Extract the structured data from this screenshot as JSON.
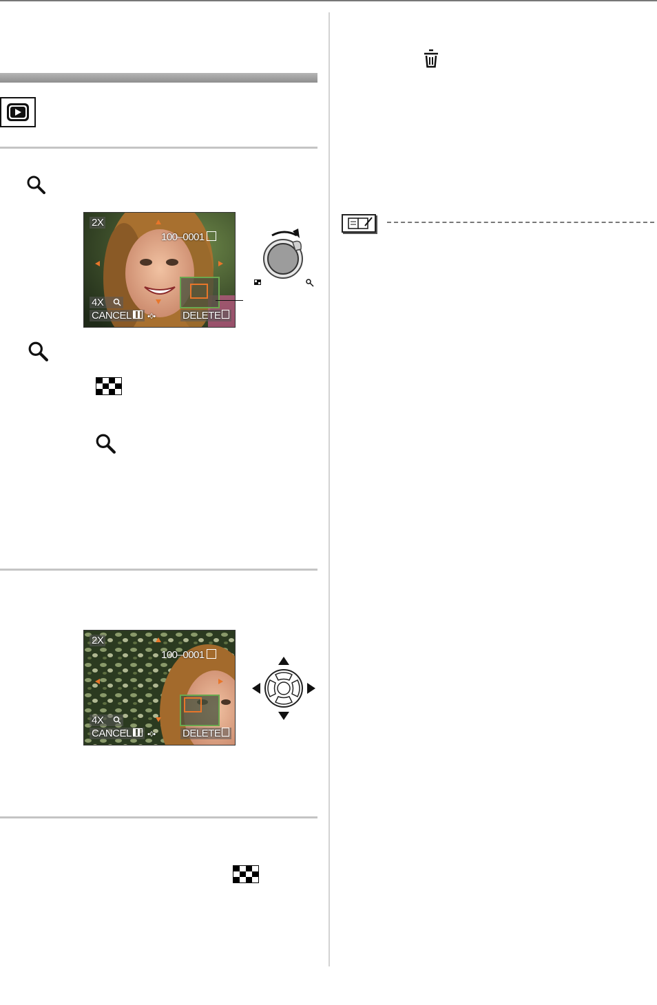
{
  "overlay_top": {
    "zoom": "2X",
    "file_number": "100–0001",
    "zoom_step": "4X",
    "cancel": "CANCEL",
    "delete": "DELETE"
  },
  "overlay_bottom": {
    "zoom": "2X",
    "file_number": "100–0001",
    "zoom_step": "4X",
    "cancel": "CANCEL",
    "delete": "DELETE"
  },
  "icons": {
    "play": "playback-mode-icon",
    "magnifier": "magnifier-icon",
    "checker": "multi-playback-icon",
    "trash": "trash-icon",
    "note": "note-icon",
    "lever": "zoom-lever-icon",
    "dpad": "cursor-buttons-icon"
  },
  "colors": {
    "section_bar": "#9e9e9e",
    "rule": "#c4c4c4",
    "overlay_arrow": "#e8762a",
    "zoom_frame": "#6aa84f"
  }
}
